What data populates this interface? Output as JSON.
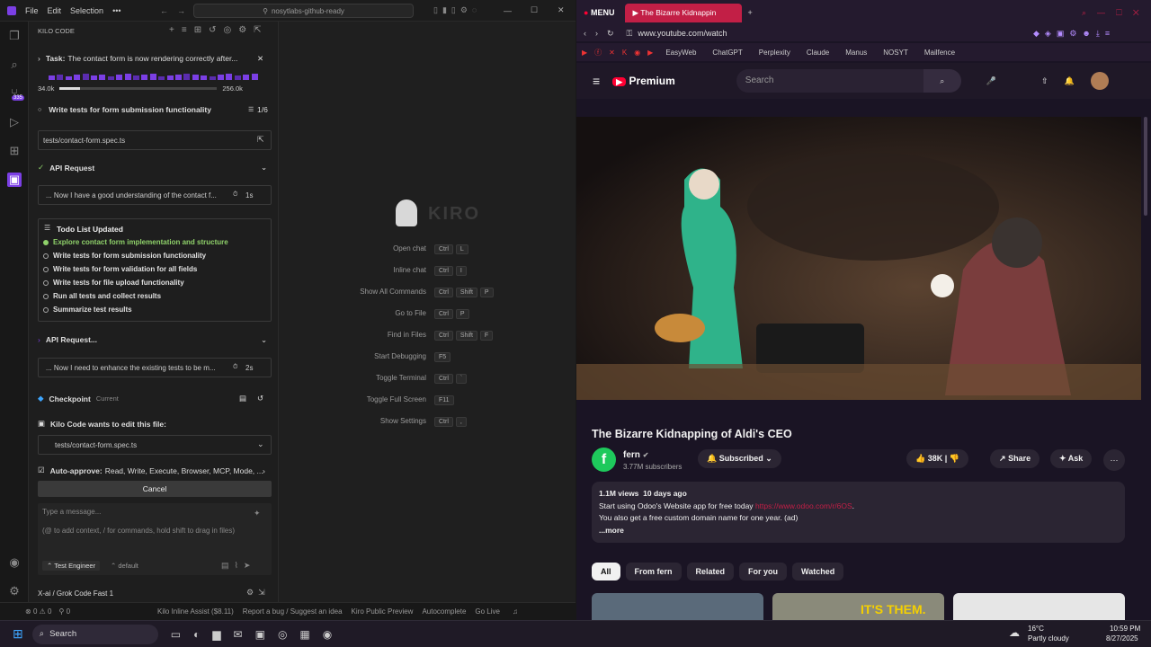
{
  "ide": {
    "menu": [
      "File",
      "Edit",
      "Selection",
      "•••"
    ],
    "search": "nosytlabs-github-ready",
    "panel_title": "KILO CODE",
    "task_label": "Task:",
    "task_text": "The contact form is now rendering correctly after...",
    "ctx_used": "34.0k",
    "ctx_max": "256.0k",
    "ctx_fraction": 0.13,
    "current_todo": "Write tests for form submission functionality",
    "todo_count": "1/6",
    "file_path": "tests/contact-form.spec.ts",
    "api1": "API Request",
    "api1_text": "... Now I have a good understanding of the contact f...",
    "api1_time": "1s",
    "todo_title": "Todo List Updated",
    "todos": [
      "Explore contact form implementation and structure",
      "Write tests for form submission functionality",
      "Write tests for form validation for all fields",
      "Write tests for file upload functionality",
      "Run all tests and collect results",
      "Summarize test results"
    ],
    "api2": "API Request...",
    "api2_text": "... Now I need to enhance the existing tests to be m...",
    "api2_time": "2s",
    "checkpoint": "Checkpoint",
    "checkpoint_tag": "Current",
    "edit_label": "Kilo Code wants to edit this file:",
    "edit_file": "tests/contact-form.spec.ts",
    "autoapprove_label": "Auto-approve:",
    "autoapprove_text": "Read, Write, Execute, Browser, MCP, Mode, ...",
    "cancel": "Cancel",
    "msg_placeholder": "Type a message...",
    "msg_hint": "(@ to add context, / for commands, hold shift to drag in files)",
    "mode": "Test Engineer",
    "profile": "default",
    "model": "X-ai / Grok Code Fast 1",
    "kiro_logo": "KIRO",
    "shortcuts": [
      {
        "label": "Open chat",
        "keys": [
          "Ctrl",
          "L"
        ]
      },
      {
        "label": "Inline chat",
        "keys": [
          "Ctrl",
          "I"
        ]
      },
      {
        "label": "Show All Commands",
        "keys": [
          "Ctrl",
          "Shift",
          "P"
        ]
      },
      {
        "label": "Go to File",
        "keys": [
          "Ctrl",
          "P"
        ]
      },
      {
        "label": "Find in Files",
        "keys": [
          "Ctrl",
          "Shift",
          "F"
        ]
      },
      {
        "label": "Start Debugging",
        "keys": [
          "F5"
        ]
      },
      {
        "label": "Toggle Terminal",
        "keys": [
          "Ctrl",
          "`"
        ]
      },
      {
        "label": "Toggle Full Screen",
        "keys": [
          "F11"
        ]
      },
      {
        "label": "Show Settings",
        "keys": [
          "Ctrl",
          ","
        ]
      }
    ],
    "status": {
      "errors": "0",
      "warnings": "0",
      "ports": "0",
      "inline": "Kilo Inline Assist ($8.11)",
      "report": "Report a bug / Suggest an idea",
      "preview": "Kiro Public Preview",
      "autocomplete": "Autocomplete",
      "golive": "Go Live"
    }
  },
  "browser": {
    "menu": "MENU",
    "tab_title": "The Bizarre Kidnappin",
    "url": "www.youtube.com/watch",
    "bookmarks": [
      "EasyWeb",
      "ChatGPT",
      "Perplexity",
      "Claude",
      "Manus",
      "NOSYT",
      "Mailfence"
    ],
    "yt": {
      "brand": "Premium",
      "search_placeholder": "Search",
      "title": "The Bizarre Kidnapping of Aldi's CEO",
      "channel": "fern",
      "channel_initial": "f",
      "subs": "3.77M subscribers",
      "subscribed": "Subscribed",
      "likes": "38K",
      "share": "Share",
      "ask": "Ask",
      "views": "1.1M views",
      "ago": "10 days ago",
      "desc1": "Start using Odoo's Website app for free today ",
      "desc_link": "https://www.odoo.com/r/6OS",
      "desc1_end": ".",
      "desc2": "You also get a free custom domain name for one year. (ad)",
      "more": "...more",
      "chips": [
        "All",
        "From fern",
        "Related",
        "For you",
        "Watched"
      ],
      "thumb_text": "IT'S THEM."
    }
  },
  "taskbar": {
    "search": "Search",
    "temp": "16°C",
    "weather": "Partly cloudy",
    "time": "10:59 PM",
    "date": "8/27/2025"
  },
  "colors": {
    "kilo_purple": "#7b3fe4",
    "todo_done": "#8fd16a",
    "yt_red": "#ff0033",
    "link": "#3ea6ff"
  }
}
